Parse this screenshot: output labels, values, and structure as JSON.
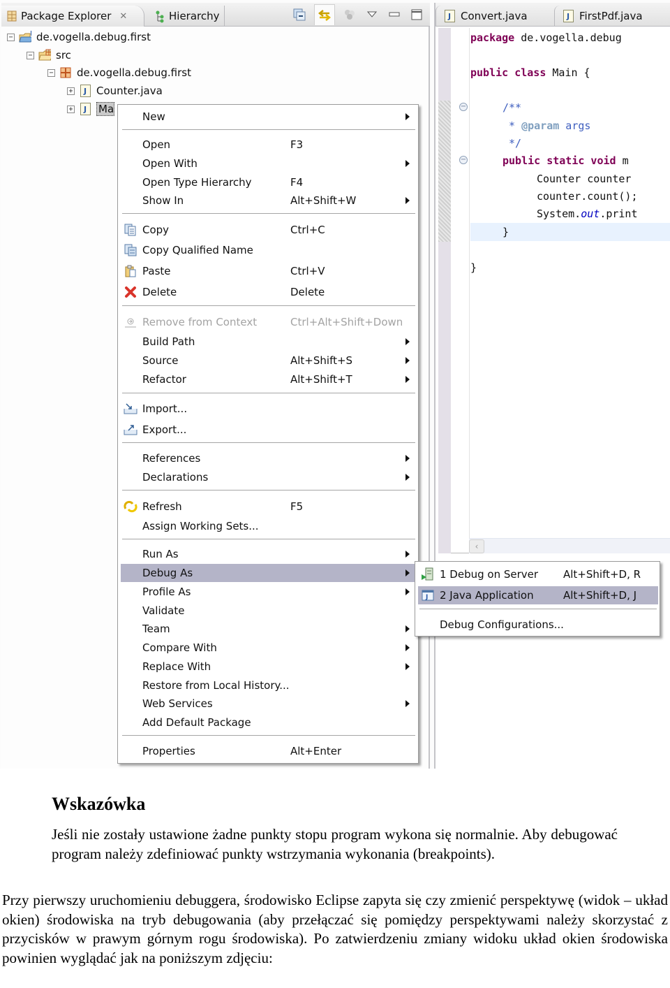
{
  "package_explorer": {
    "tabs": [
      {
        "label": "Package Explorer",
        "icon": "package-explorer-icon",
        "active": true,
        "closable": true
      },
      {
        "label": "Hierarchy",
        "icon": "hierarchy-icon",
        "active": false
      }
    ],
    "toolbar": [
      "collapse-all-icon",
      "link-with-editor-icon",
      "focus-on-active-task-icon",
      "view-menu-icon",
      "minimize-icon",
      "maximize-icon"
    ],
    "close_glyph": "✕",
    "tree": [
      {
        "label": "de.vogella.debug.first",
        "type": "project",
        "expanded": true
      },
      {
        "label": "src",
        "type": "source-folder",
        "expanded": true
      },
      {
        "label": "de.vogella.debug.first",
        "type": "package",
        "expanded": true
      },
      {
        "label": "Counter.java",
        "type": "java-file",
        "expanded": false
      },
      {
        "label": "Main.java",
        "visible_label": "Ma",
        "type": "java-file",
        "expanded": false,
        "selected": true
      }
    ]
  },
  "editor": {
    "tabs": [
      {
        "label": "Convert.java"
      },
      {
        "label": "FirstPdf.java"
      }
    ],
    "code_lines": [
      {
        "kw": "package",
        "rest": " de.vogella.debug"
      },
      {
        "kw": "public class",
        "rest": " Main {"
      },
      {
        "comment": "/**"
      },
      {
        "comment_pre": " * ",
        "tag": "@param",
        "comment_post": " args"
      },
      {
        "comment": " */"
      },
      {
        "kw": "public static void",
        "rest": " m"
      },
      {
        "text": "Counter counter "
      },
      {
        "text": "counter.count();"
      },
      {
        "pre": "System.",
        "field": "out",
        "post": ".print"
      },
      {
        "text": "}"
      },
      {
        "text": "}"
      }
    ]
  },
  "context_menu": {
    "items": [
      {
        "label": "New",
        "submenu": true
      },
      {
        "label": "Open",
        "shortcut": "F3"
      },
      {
        "label": "Open With",
        "submenu": true
      },
      {
        "label": "Open Type Hierarchy",
        "shortcut": "F4"
      },
      {
        "label": "Show In",
        "shortcut": "Alt+Shift+W",
        "submenu": true
      },
      {
        "label": "Copy",
        "shortcut": "Ctrl+C",
        "icon": "copy-icon"
      },
      {
        "label": "Copy Qualified Name",
        "icon": "copy-qualified-name-icon"
      },
      {
        "label": "Paste",
        "shortcut": "Ctrl+V",
        "icon": "paste-icon"
      },
      {
        "label": "Delete",
        "shortcut": "Delete",
        "icon": "delete-icon"
      },
      {
        "label": "Remove from Context",
        "shortcut": "Ctrl+Alt+Shift+Down",
        "icon": "remove-from-context-icon",
        "disabled": true
      },
      {
        "label": "Build Path",
        "submenu": true
      },
      {
        "label": "Source",
        "shortcut": "Alt+Shift+S",
        "submenu": true
      },
      {
        "label": "Refactor",
        "shortcut": "Alt+Shift+T",
        "submenu": true
      },
      {
        "label": "Import...",
        "icon": "import-icon"
      },
      {
        "label": "Export...",
        "icon": "export-icon"
      },
      {
        "label": "References",
        "submenu": true
      },
      {
        "label": "Declarations",
        "submenu": true
      },
      {
        "label": "Refresh",
        "shortcut": "F5",
        "icon": "refresh-icon"
      },
      {
        "label": "Assign Working Sets..."
      },
      {
        "label": "Run As",
        "submenu": true
      },
      {
        "label": "Debug As",
        "submenu": true,
        "highlighted": true
      },
      {
        "label": "Profile As",
        "submenu": true
      },
      {
        "label": "Validate"
      },
      {
        "label": "Team",
        "submenu": true
      },
      {
        "label": "Compare With",
        "submenu": true
      },
      {
        "label": "Replace With",
        "submenu": true
      },
      {
        "label": "Restore from Local History..."
      },
      {
        "label": "Web Services",
        "submenu": true
      },
      {
        "label": "Add Default Package"
      },
      {
        "label": "Properties",
        "shortcut": "Alt+Enter"
      }
    ]
  },
  "debug_submenu": {
    "items": [
      {
        "label": "1 Debug on Server",
        "shortcut": "Alt+Shift+D, R",
        "icon": "debug-on-server-icon"
      },
      {
        "label": "2 Java Application",
        "shortcut": "Alt+Shift+D, J",
        "icon": "java-application-icon",
        "highlighted": true
      },
      {
        "label": "Debug Configurations..."
      }
    ]
  },
  "document": {
    "note_title": "Wskazówka",
    "note_body": "Jeśli nie zostały ustawione żadne punkty stopu program wykona się normalnie. Aby debugować program należy zdefiniować punkty wstrzymania wykonania (breakpoints).",
    "paragraph": "Przy pierwszy uruchomieniu debuggera, środowisko Eclipse zapyta się czy zmienić perspektywę (widok – układ okien) środowiska na tryb debugowania (aby przełączać się pomiędzy perspektywami należy skorzystać z przycisków w prawym górnym rogu środowiska). Po zatwierdzeniu zmiany widoku układ okien środowiska powinien wyglądać jak na poniższym zdjęciu:"
  },
  "colors": {
    "keyword": "#7f0055",
    "javadoc": "#3f5fbf",
    "menu_highlight": "#b4b4c8",
    "current_line": "#e8f2fe"
  }
}
